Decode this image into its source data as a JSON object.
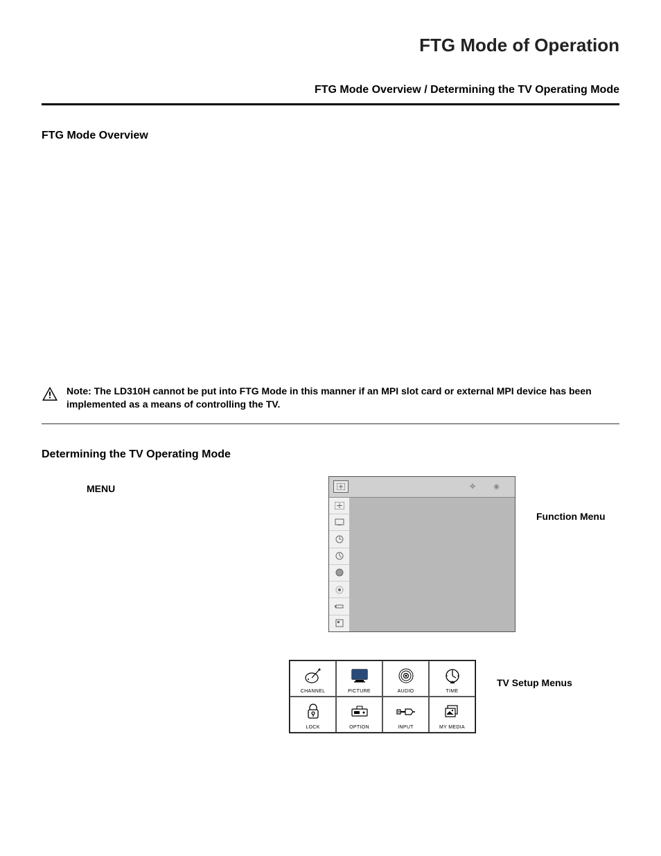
{
  "page_title": "FTG Mode of Operation",
  "sub_header": "FTG Mode Overview / Determining the TV Operating Mode",
  "section1": "FTG Mode Overview",
  "warning_note": "Note: The LD310H cannot be put into FTG Mode in this manner if an MPI slot card or external MPI device has been implemented as a means of controlling the TV.",
  "section2": "Determining the TV Operating Mode",
  "menu_label": "MENU",
  "func_menu_label": "Function Menu",
  "setup_menu_label": "TV Setup Menus",
  "setup_cells": [
    {
      "label": "CHANNEL"
    },
    {
      "label": "PICTURE"
    },
    {
      "label": "AUDIO"
    },
    {
      "label": "TIME"
    },
    {
      "label": "LOCK"
    },
    {
      "label": "OPTION"
    },
    {
      "label": "INPUT"
    },
    {
      "label": "MY MEDIA"
    }
  ],
  "page_number": "",
  "doc_code": ""
}
